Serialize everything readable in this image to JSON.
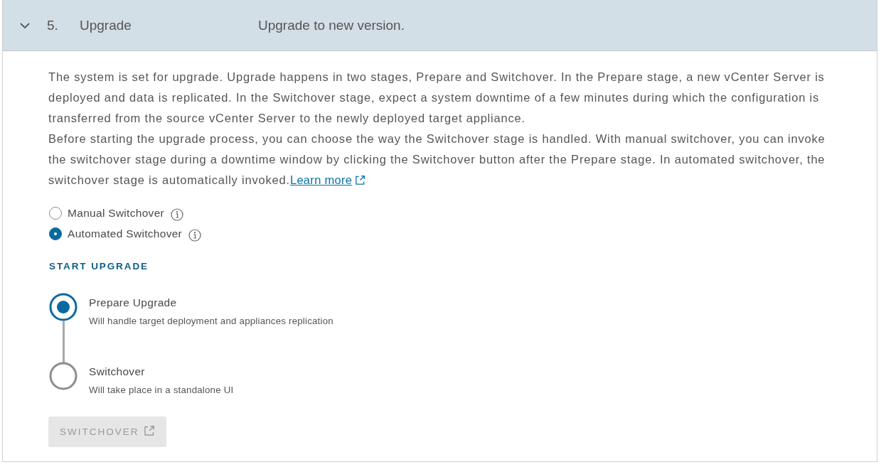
{
  "section": {
    "expanded": true,
    "number": "5.",
    "title": "Upgrade",
    "description": "Upgrade to new version."
  },
  "paragraphs": [
    "The system is set for upgrade. Upgrade happens in two stages, Prepare and Switchover. In the Prepare stage, a new vCenter Server is deployed and data is replicated. In the Switchover stage, expect a system downtime of a few minutes during which the configuration is transferred from the source vCenter Server to the newly deployed target appliance.",
    "Before starting the upgrade process, you can choose the way the Switchover stage is handled. With manual switchover, you can invoke the switchover stage during a downtime window by clicking the Switchover button after the Prepare stage. In automated switchover, the switchover stage is automatically invoked."
  ],
  "learn_more_link": "Learn more",
  "switchover_options": [
    {
      "label": "Manual Switchover",
      "selected": false
    },
    {
      "label": "Automated Switchover",
      "selected": true
    }
  ],
  "start_upgrade": {
    "heading": "START UPGRADE",
    "steps": [
      {
        "title": "Prepare Upgrade",
        "description": "Will handle target deployment and appliances replication",
        "selected": true
      },
      {
        "title": "Switchover",
        "description": "Will take place in a standalone UI",
        "selected": false
      }
    ]
  },
  "switchover_button": {
    "label": "SWITCHOVER",
    "disabled": true
  }
}
